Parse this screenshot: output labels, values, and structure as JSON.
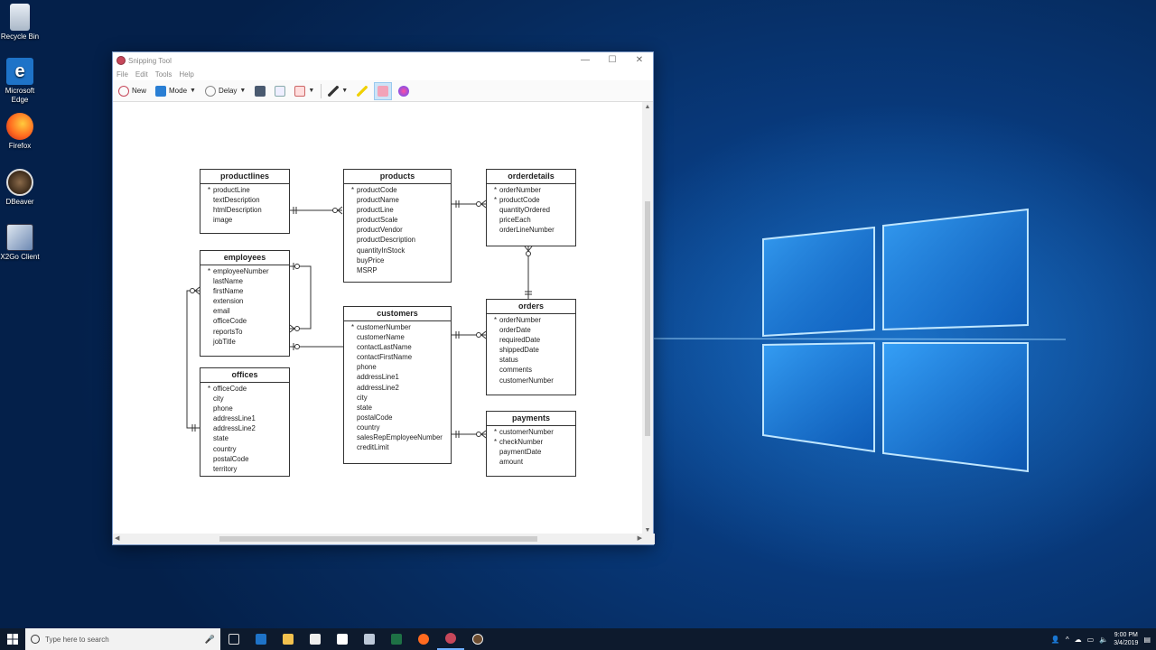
{
  "desktop": {
    "icons": [
      {
        "label": "Recycle Bin"
      },
      {
        "label": "Microsoft Edge"
      },
      {
        "label": "Firefox"
      },
      {
        "label": "DBeaver"
      },
      {
        "label": "X2Go Client"
      }
    ]
  },
  "window": {
    "title": "Snipping Tool",
    "controls": {
      "minimize": "—",
      "maximize": "☐",
      "close": "✕"
    },
    "menu": [
      "File",
      "Edit",
      "Tools",
      "Help"
    ],
    "toolbar": {
      "new_label": "New",
      "mode_label": "Mode",
      "delay_label": "Delay",
      "icons": [
        "new-snip-icon",
        "mode-icon",
        "delay-clock-icon",
        "save-icon",
        "copy-icon",
        "email-icon",
        "pen-icon",
        "highlighter-icon",
        "eraser-icon",
        "paint3d-icon"
      ]
    }
  },
  "diagram": {
    "entities": {
      "productlines": {
        "name": "productlines",
        "fields": [
          {
            "pk": "*",
            "name": "productLine"
          },
          {
            "pk": "",
            "name": "textDescription"
          },
          {
            "pk": "",
            "name": "htmlDescription"
          },
          {
            "pk": "",
            "name": "image"
          }
        ]
      },
      "products": {
        "name": "products",
        "fields": [
          {
            "pk": "*",
            "name": "productCode"
          },
          {
            "pk": "",
            "name": "productName"
          },
          {
            "pk": "",
            "name": "productLine"
          },
          {
            "pk": "",
            "name": "productScale"
          },
          {
            "pk": "",
            "name": "productVendor"
          },
          {
            "pk": "",
            "name": "productDescription"
          },
          {
            "pk": "",
            "name": "quantityInStock"
          },
          {
            "pk": "",
            "name": "buyPrice"
          },
          {
            "pk": "",
            "name": "MSRP"
          }
        ]
      },
      "orderdetails": {
        "name": "orderdetails",
        "fields": [
          {
            "pk": "*",
            "name": "orderNumber"
          },
          {
            "pk": "*",
            "name": "productCode"
          },
          {
            "pk": "",
            "name": "quantityOrdered"
          },
          {
            "pk": "",
            "name": "priceEach"
          },
          {
            "pk": "",
            "name": "orderLineNumber"
          }
        ]
      },
      "employees": {
        "name": "employees",
        "fields": [
          {
            "pk": "*",
            "name": "employeeNumber"
          },
          {
            "pk": "",
            "name": "lastName"
          },
          {
            "pk": "",
            "name": "firstName"
          },
          {
            "pk": "",
            "name": "extension"
          },
          {
            "pk": "",
            "name": "email"
          },
          {
            "pk": "",
            "name": "officeCode"
          },
          {
            "pk": "",
            "name": "reportsTo"
          },
          {
            "pk": "",
            "name": "jobTitle"
          }
        ]
      },
      "customers": {
        "name": "customers",
        "fields": [
          {
            "pk": "*",
            "name": "customerNumber"
          },
          {
            "pk": "",
            "name": "customerName"
          },
          {
            "pk": "",
            "name": "contactLastName"
          },
          {
            "pk": "",
            "name": "contactFirstName"
          },
          {
            "pk": "",
            "name": "phone"
          },
          {
            "pk": "",
            "name": "addressLine1"
          },
          {
            "pk": "",
            "name": "addressLine2"
          },
          {
            "pk": "",
            "name": "city"
          },
          {
            "pk": "",
            "name": "state"
          },
          {
            "pk": "",
            "name": "postalCode"
          },
          {
            "pk": "",
            "name": "country"
          },
          {
            "pk": "",
            "name": "salesRepEmployeeNumber"
          },
          {
            "pk": "",
            "name": "creditLimit"
          }
        ]
      },
      "orders": {
        "name": "orders",
        "fields": [
          {
            "pk": "*",
            "name": "orderNumber"
          },
          {
            "pk": "",
            "name": "orderDate"
          },
          {
            "pk": "",
            "name": "requiredDate"
          },
          {
            "pk": "",
            "name": "shippedDate"
          },
          {
            "pk": "",
            "name": "status"
          },
          {
            "pk": "",
            "name": "comments"
          },
          {
            "pk": "",
            "name": "customerNumber"
          }
        ]
      },
      "offices": {
        "name": "offices",
        "fields": [
          {
            "pk": "*",
            "name": "officeCode"
          },
          {
            "pk": "",
            "name": "city"
          },
          {
            "pk": "",
            "name": "phone"
          },
          {
            "pk": "",
            "name": "addressLine1"
          },
          {
            "pk": "",
            "name": "addressLine2"
          },
          {
            "pk": "",
            "name": "state"
          },
          {
            "pk": "",
            "name": "country"
          },
          {
            "pk": "",
            "name": "postalCode"
          },
          {
            "pk": "",
            "name": "territory"
          }
        ]
      },
      "payments": {
        "name": "payments",
        "fields": [
          {
            "pk": "*",
            "name": "customerNumber"
          },
          {
            "pk": "*",
            "name": "checkNumber"
          },
          {
            "pk": "",
            "name": "paymentDate"
          },
          {
            "pk": "",
            "name": "amount"
          }
        ]
      }
    }
  },
  "taskbar": {
    "search_placeholder": "Type here to search",
    "apps": [
      "task-view-icon",
      "edge-icon",
      "file-explorer-icon",
      "store-icon",
      "mail-icon",
      "sticky-icon",
      "excel-icon",
      "firefox-icon",
      "snipping-tool-icon",
      "dbeaver-icon"
    ],
    "time": "9:00 PM",
    "date": "3/4/2019"
  },
  "colors": {
    "accent": "#0078d7",
    "taskbar": "#0d1a2d",
    "wallpaper": "#083a7d"
  }
}
